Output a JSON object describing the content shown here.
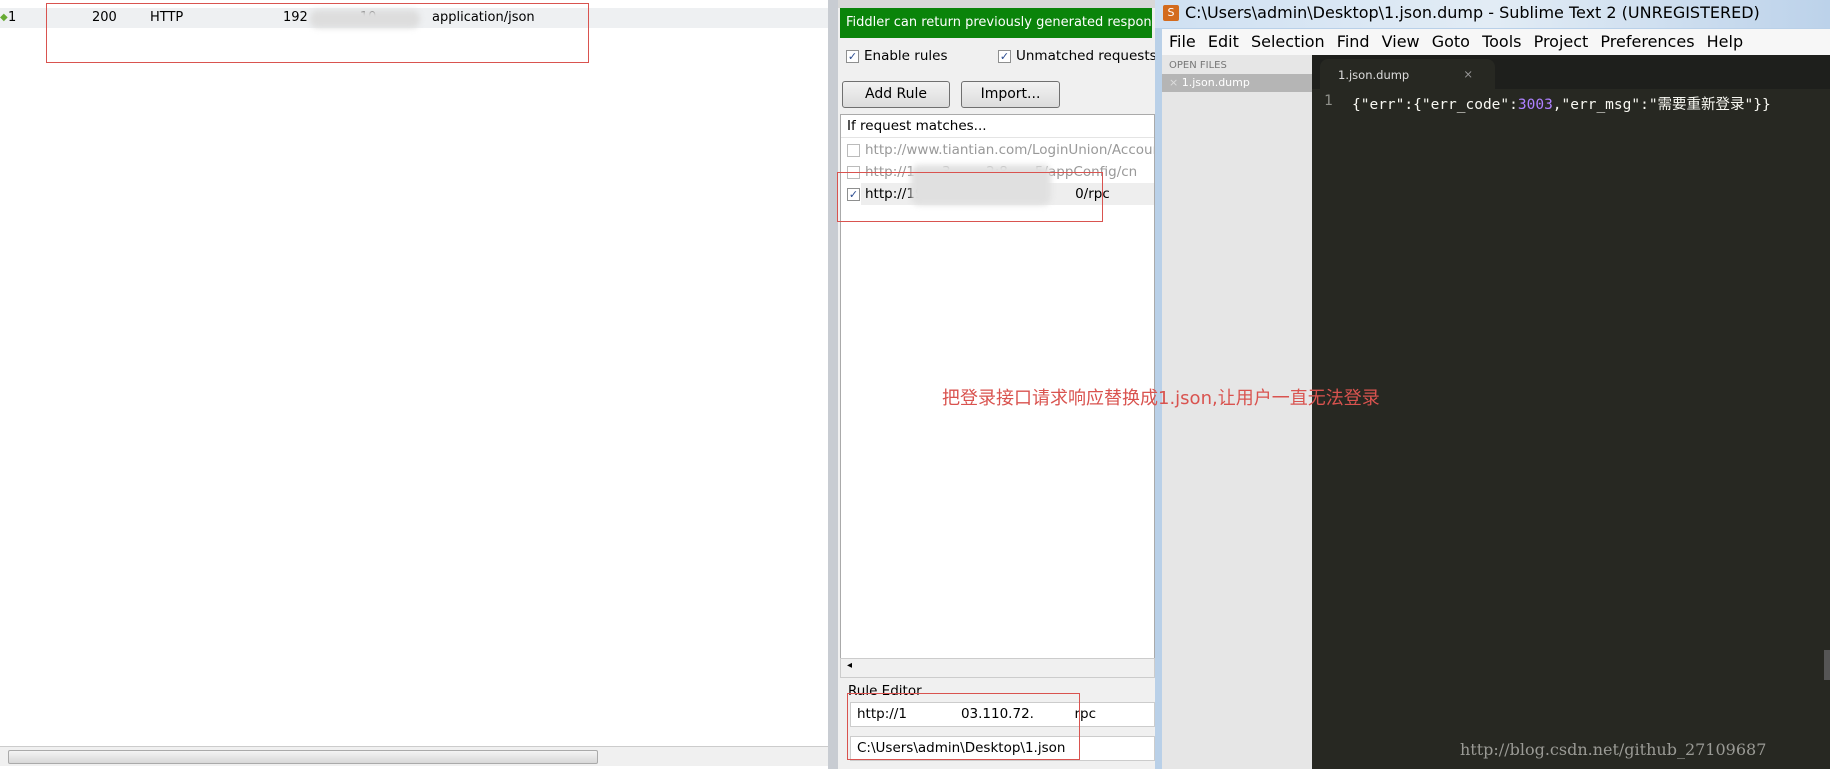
{
  "sessions": {
    "row": {
      "id": "1",
      "result": "200",
      "protocol": "HTTP",
      "host": "192    10",
      "content_type": "application/json"
    }
  },
  "fiddler": {
    "banner": "Fiddler can return previously generated responses",
    "enable_rules": "Enable rules",
    "unmatched": "Unmatched requests p",
    "add_rule": "Add Rule",
    "import": "Import...",
    "list_header": "If request matches...",
    "rules": [
      {
        "text": "http://www.tiantian.com/LoginUnion/Account/A",
        "checked": false
      },
      {
        "text": "http://1  3.  .2:8  5/appConfig/cn",
        "checked": false
      },
      {
        "text": "http://19    2.11     0/rpc",
        "checked": true
      }
    ],
    "rule_editor_label": "Rule Editor",
    "match_value": "http://1    03.110.72.   rpc",
    "response_value": "C:\\Users\\admin\\Desktop\\1.json"
  },
  "annotation": "把登录接口请求响应替换成1.json,让用户一直无法登录",
  "sublime": {
    "title": "C:\\Users\\admin\\Desktop\\1.json.dump - Sublime Text 2 (UNREGISTERED)",
    "menu": [
      "File",
      "Edit",
      "Selection",
      "Find",
      "View",
      "Goto",
      "Tools",
      "Project",
      "Preferences",
      "Help"
    ],
    "open_files_label": "OPEN FILES",
    "open_file": "1.json.dump",
    "tab": "1.json.dump",
    "line_number": "1",
    "code": {
      "p1": "{\"err\":{\"err_code\":",
      "num": "3003",
      "p2": ",\"err_msg\":\"需要重新登录\"}}"
    }
  },
  "watermark": "http://blog.csdn.net/github_27109687",
  "colors": {
    "banner": "#0a840a",
    "annotation": "#d9534f",
    "editor_bg": "#272822",
    "number": "#ae81ff"
  }
}
